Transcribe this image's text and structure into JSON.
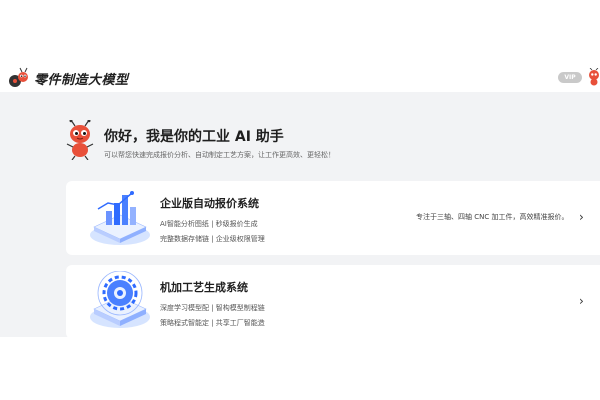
{
  "header": {
    "brand": "零件制造大模型",
    "vip_label": "VIP"
  },
  "hero": {
    "greeting": "你好，我是你的工业 AI 助手",
    "subtitle": "可以帮您快速完成报价分析、自动制定工艺方案，让工作更高效、更轻松！"
  },
  "cards": [
    {
      "title": "企业版自动报价系统",
      "line1": "AI智能分析图纸 | 秒级报价生成",
      "line2": "完整数据存储链 | 企业级权限管理",
      "description": "专注于三轴、四轴 CNC 加工件，高效精准报价。"
    },
    {
      "title": "机加工艺生成系统",
      "line1": "深度学习模型配 | 智构模型制程链",
      "line2": "策略程式智能定 | 共享工厂智能造",
      "description": ""
    }
  ],
  "colors": {
    "accent_blue": "#2f6bff",
    "ant_red": "#e8503a",
    "background": "#f2f3f5"
  },
  "icons": {
    "chevron": "chevron-right-icon"
  }
}
